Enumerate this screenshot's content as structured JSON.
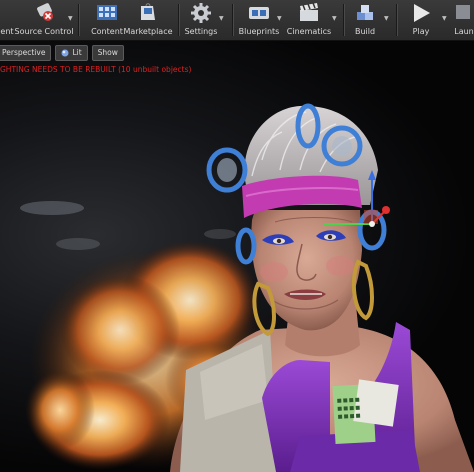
{
  "toolbar": {
    "items": [
      {
        "label": "ent"
      },
      {
        "label": "Source Control"
      },
      {
        "label": "Content"
      },
      {
        "label": "Marketplace"
      },
      {
        "label": "Settings"
      },
      {
        "label": "Blueprints"
      },
      {
        "label": "Cinematics"
      },
      {
        "label": "Build"
      },
      {
        "label": "Play"
      },
      {
        "label": "Laun"
      }
    ]
  },
  "viewport": {
    "perspective_label": "Perspective",
    "lit_label": "Lit",
    "show_label": "Show",
    "warning": "GHTING NEEDS TO BE REBUILT (10 unbuilt objects)"
  },
  "colors": {
    "warning": "#e02020",
    "headband": "#c23bb0",
    "rollers": "#3f7fd6",
    "top": "#7a2ec2",
    "gizmo_x": "#e03030",
    "gizmo_y": "#4fd04f",
    "gizmo_z": "#3a6fe0"
  }
}
